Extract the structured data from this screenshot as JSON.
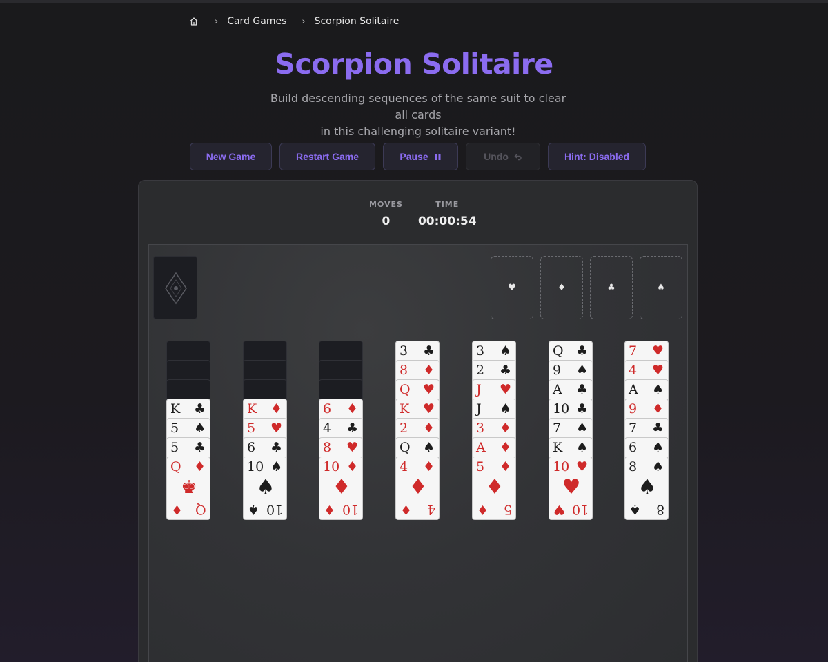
{
  "breadcrumb": {
    "items": [
      "Card Games",
      "Scorpion Solitaire"
    ]
  },
  "title": "Scorpion Solitaire",
  "subtitle_line1": "Build descending sequences of the same suit to clear all cards",
  "subtitle_line2": "in this challenging solitaire variant!",
  "buttons": {
    "new_game": "New Game",
    "restart": "Restart Game",
    "pause": "Pause",
    "undo": "Undo",
    "hint": "Hint: Disabled"
  },
  "stats": {
    "moves_label": "MOVES",
    "moves": "0",
    "time_label": "TIME",
    "time": "00:00:54"
  },
  "foundations": [
    "♥",
    "♦",
    "♣",
    "♠"
  ],
  "colors": {
    "accent": "#8b6cf0",
    "red_suit": "#cf2a2a",
    "black_suit": "#1d1d1d"
  },
  "tableau": [
    {
      "facedown": 3,
      "cards": [
        {
          "r": "K",
          "s": "♣"
        },
        {
          "r": "5",
          "s": "♠"
        },
        {
          "r": "5",
          "s": "♣"
        },
        {
          "r": "Q",
          "s": "♦",
          "center": "♚"
        }
      ]
    },
    {
      "facedown": 3,
      "cards": [
        {
          "r": "K",
          "s": "♦"
        },
        {
          "r": "5",
          "s": "♥"
        },
        {
          "r": "6",
          "s": "♣"
        },
        {
          "r": "10",
          "s": "♠"
        }
      ]
    },
    {
      "facedown": 3,
      "cards": [
        {
          "r": "6",
          "s": "♦"
        },
        {
          "r": "4",
          "s": "♣"
        },
        {
          "r": "8",
          "s": "♥"
        },
        {
          "r": "10",
          "s": "♦"
        }
      ]
    },
    {
      "facedown": 0,
      "cards": [
        {
          "r": "3",
          "s": "♣"
        },
        {
          "r": "8",
          "s": "♦"
        },
        {
          "r": "Q",
          "s": "♥"
        },
        {
          "r": "K",
          "s": "♥"
        },
        {
          "r": "2",
          "s": "♦"
        },
        {
          "r": "Q",
          "s": "♠"
        },
        {
          "r": "4",
          "s": "♦"
        }
      ]
    },
    {
      "facedown": 0,
      "cards": [
        {
          "r": "3",
          "s": "♠"
        },
        {
          "r": "2",
          "s": "♣"
        },
        {
          "r": "J",
          "s": "♥"
        },
        {
          "r": "J",
          "s": "♠"
        },
        {
          "r": "3",
          "s": "♦"
        },
        {
          "r": "A",
          "s": "♦"
        },
        {
          "r": "5",
          "s": "♦"
        }
      ]
    },
    {
      "facedown": 0,
      "cards": [
        {
          "r": "Q",
          "s": "♣"
        },
        {
          "r": "9",
          "s": "♠"
        },
        {
          "r": "A",
          "s": "♣"
        },
        {
          "r": "10",
          "s": "♣"
        },
        {
          "r": "7",
          "s": "♠"
        },
        {
          "r": "K",
          "s": "♠"
        },
        {
          "r": "10",
          "s": "♥"
        }
      ]
    },
    {
      "facedown": 0,
      "cards": [
        {
          "r": "7",
          "s": "♥"
        },
        {
          "r": "4",
          "s": "♥"
        },
        {
          "r": "A",
          "s": "♠"
        },
        {
          "r": "9",
          "s": "♦"
        },
        {
          "r": "7",
          "s": "♣"
        },
        {
          "r": "6",
          "s": "♠"
        },
        {
          "r": "8",
          "s": "♠"
        }
      ]
    }
  ]
}
